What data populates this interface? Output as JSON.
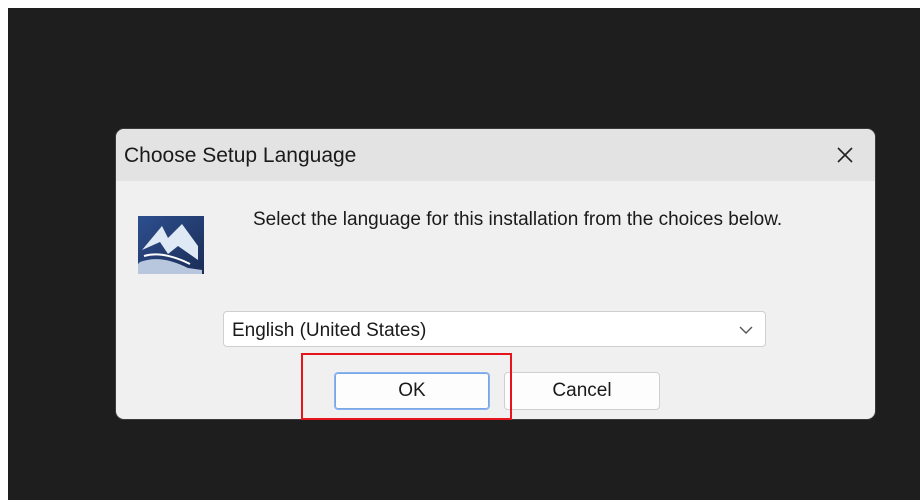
{
  "dialog": {
    "title": "Choose Setup Language",
    "close_icon": "close-icon",
    "setup_icon": "installer-icon",
    "prompt": "Select the language for this installation from the choices below.",
    "language_select": {
      "selected_value": "English (United States)",
      "chevron_icon": "chevron-down-icon"
    },
    "buttons": {
      "ok_label": "OK",
      "cancel_label": "Cancel"
    }
  },
  "annotation": {
    "highlight_color": "#e8141c",
    "highlighted_element": "ok-button"
  },
  "colors": {
    "desktop_background": "#1e1e1e",
    "dialog_background": "#f0f0f0",
    "titlebar_background": "#e3e3e3",
    "ok_focus_border": "#8ab4f0"
  }
}
